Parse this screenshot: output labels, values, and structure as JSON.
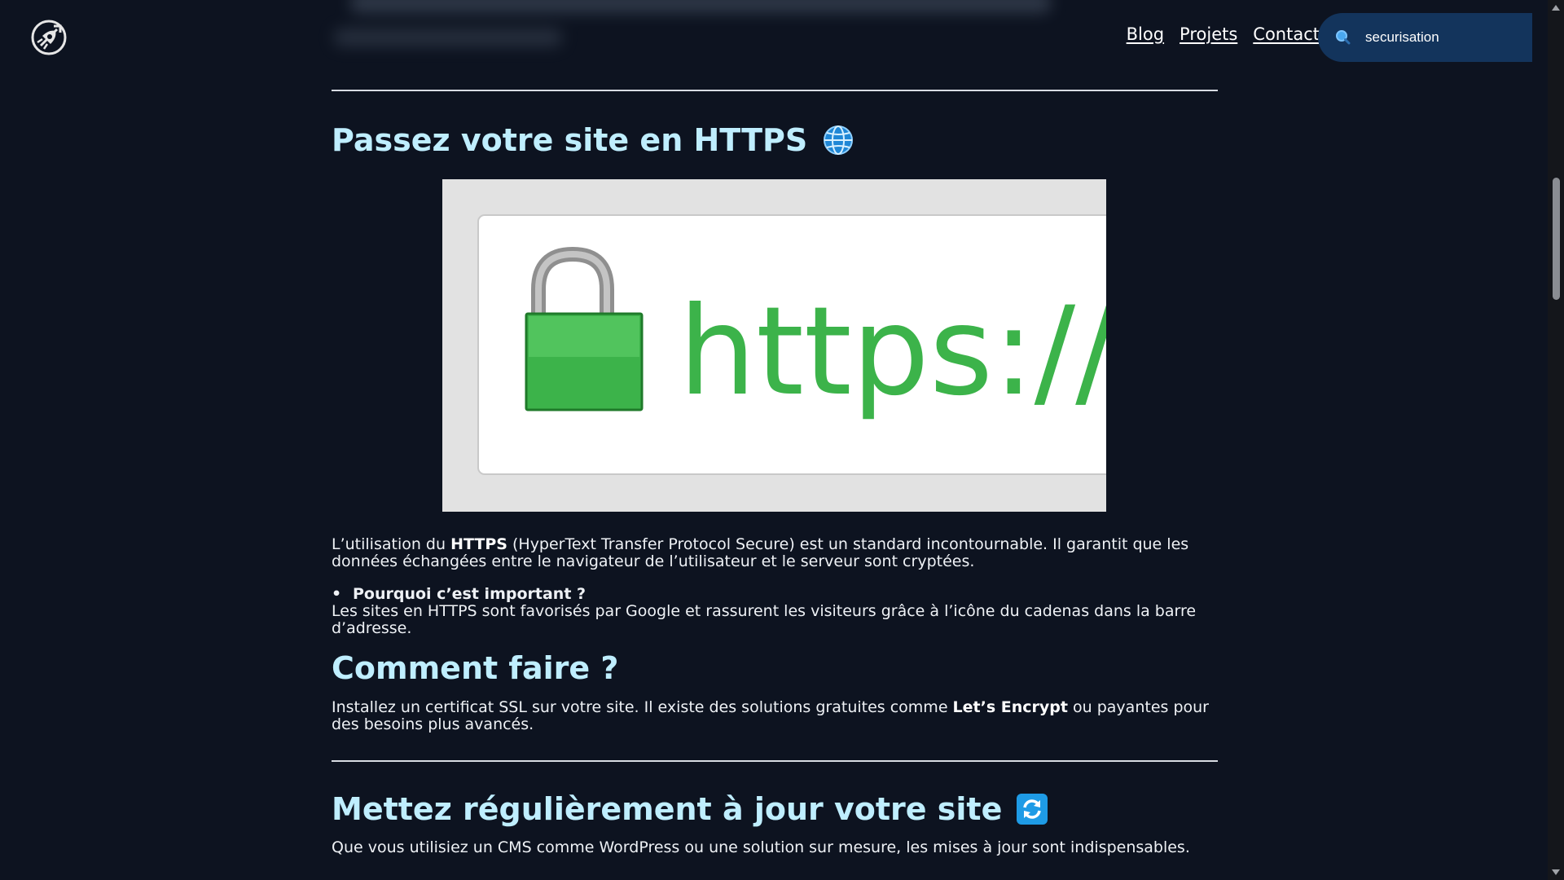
{
  "header": {
    "nav": [
      {
        "label": "Blog"
      },
      {
        "label": "Projets"
      },
      {
        "label": "Contact"
      }
    ],
    "search": {
      "value": "securisation",
      "icon": "search-icon"
    },
    "logo_icon": "rocket-logo-icon"
  },
  "article": {
    "section_https": {
      "title": "Passez votre site en HTTPS",
      "title_icon": "globe-icon",
      "image": {
        "text": "https://",
        "icon": "green-padlock-icon"
      },
      "intro": {
        "before": "L’utilisation du ",
        "bold": "HTTPS",
        "after": " (HyperText Transfer Protocol Secure) est un standard incontournable. Il garantit que les données échangées entre le navigateur de l’utilisateur et le serveur sont cryptées."
      },
      "point": {
        "title": "Pourquoi c’est important ?",
        "text": "Les sites en HTTPS sont favorisés par Google et rassurent les visiteurs grâce à l’icône du cadenas dans la barre d’adresse."
      }
    },
    "section_how": {
      "title": "Comment faire ?",
      "text": {
        "before": "Installez un certificat SSL sur votre site. Il existe des solutions gratuites comme ",
        "bold": "Let’s Encrypt",
        "after": " ou payantes pour des besoins plus avancés."
      }
    },
    "section_update": {
      "title": "Mettez régulièrement à jour votre site",
      "title_icon": "refresh-icon",
      "text": "Que vous utilisiez un CMS comme WordPress ou une solution sur mesure, les mises à jour sont indispensables."
    }
  },
  "colors": {
    "background": "#0d1320",
    "heading": "#bfeeff",
    "search_bg": "#13345c",
    "https_green": "#3cb34a"
  }
}
